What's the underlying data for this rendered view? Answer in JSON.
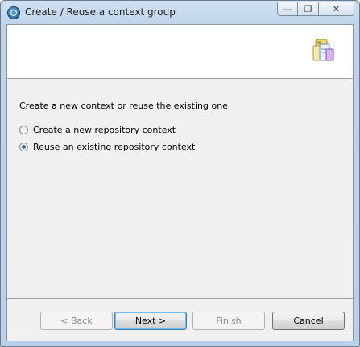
{
  "window": {
    "title": "Create / Reuse a context group",
    "controls": {
      "minimize": "—",
      "maximize": "❐",
      "close": "✕"
    },
    "icon": "talend-q-icon"
  },
  "banner": {
    "icon": "context-group-icon"
  },
  "main": {
    "prompt": "Create a new context or reuse the existing one",
    "options": [
      {
        "label": "Create a new repository context",
        "checked": false
      },
      {
        "label": "Reuse an existing repository context",
        "checked": true
      }
    ]
  },
  "buttons": {
    "back": "< Back",
    "next": "Next >",
    "finish": "Finish",
    "cancel": "Cancel"
  }
}
